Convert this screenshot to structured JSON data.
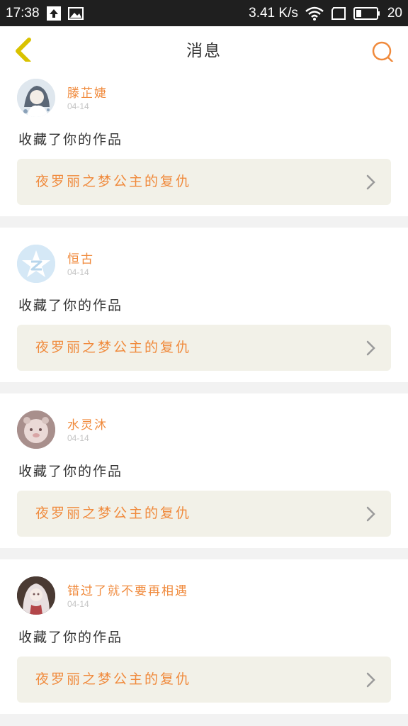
{
  "status_bar": {
    "time": "17:38",
    "net_speed": "3.41 K/s",
    "battery": "20",
    "icons": [
      "upload-icon",
      "image-icon",
      "wifi-icon",
      "sim-icon",
      "battery-icon"
    ]
  },
  "header": {
    "title": "消息",
    "back_icon": "chevron-left-icon",
    "search_icon": "search-icon"
  },
  "colors": {
    "accent": "#f08a3c",
    "back_arrow": "#d9c200",
    "work_box_bg": "#f2f1e8",
    "page_bg": "#f2f2f2"
  },
  "messages": [
    {
      "username": "滕芷婕",
      "date": "04-14",
      "action": "收藏了你的作品",
      "work_title": "夜罗丽之梦公主的复仇",
      "avatar": "anime-girl-avatar"
    },
    {
      "username": "恒古",
      "date": "04-14",
      "action": "收藏了你的作品",
      "work_title": "夜罗丽之梦公主的复仇",
      "avatar": "qzone-logo-avatar"
    },
    {
      "username": "水灵沐",
      "date": "04-14",
      "action": "收藏了你的作品",
      "work_title": "夜罗丽之梦公主的复仇",
      "avatar": "plush-toy-avatar"
    },
    {
      "username": "错过了就不要再相遇",
      "date": "04-14",
      "action": "收藏了你的作品",
      "work_title": "夜罗丽之梦公主的复仇",
      "avatar": "anime-girl-avatar"
    }
  ]
}
